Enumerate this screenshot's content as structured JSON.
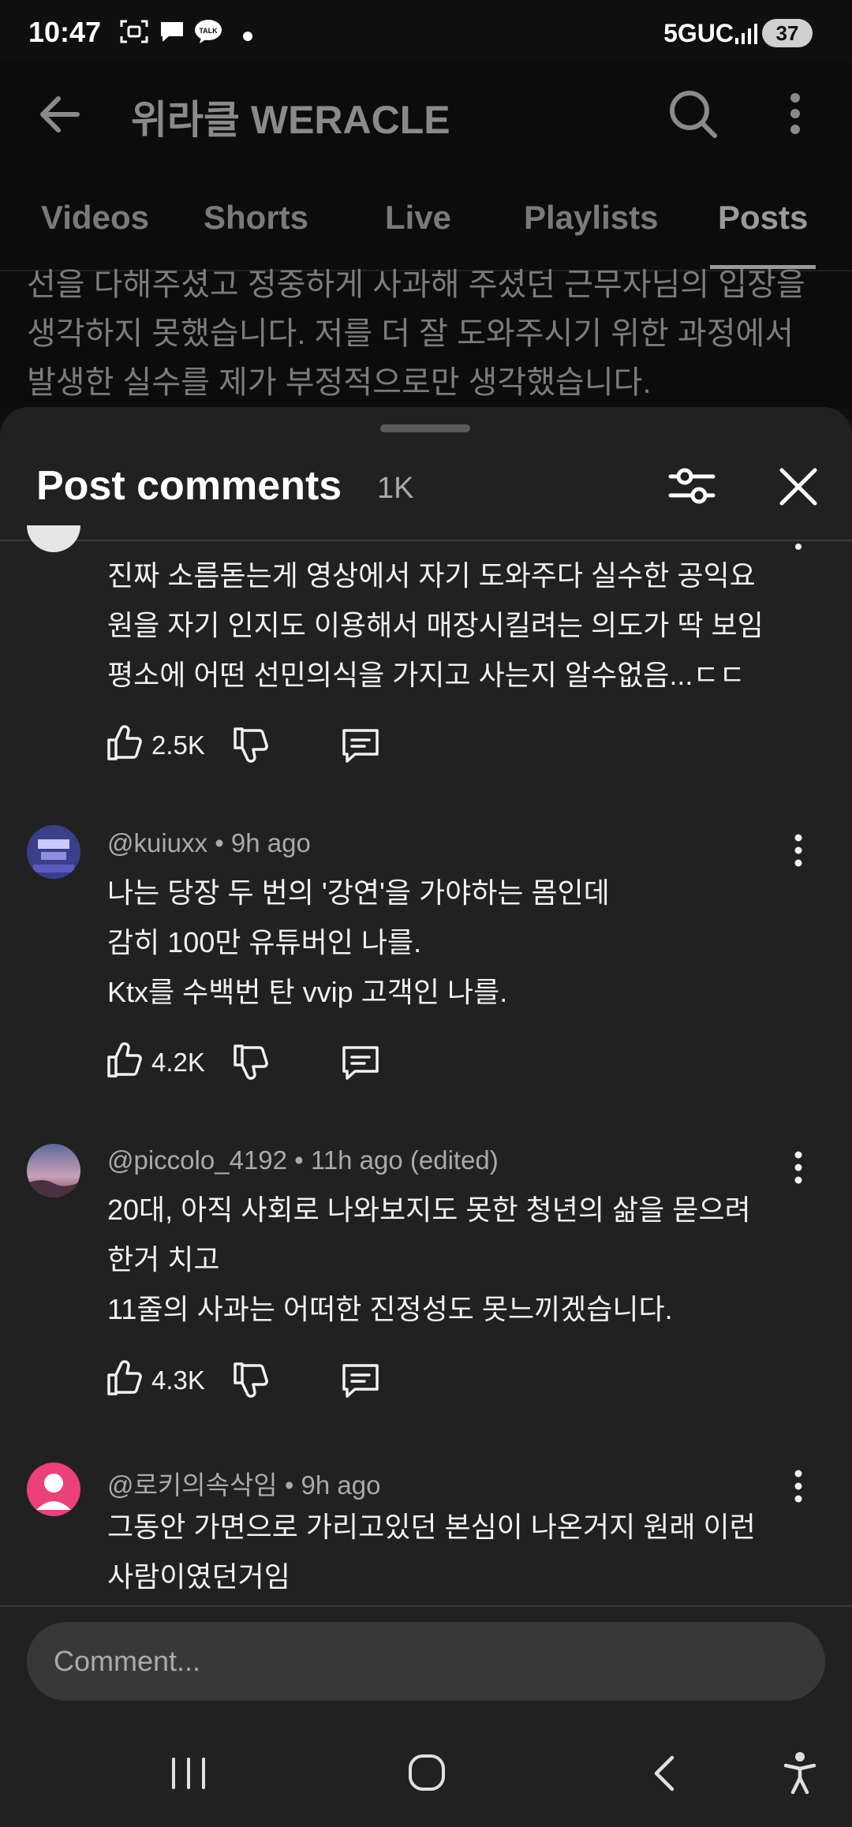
{
  "status": {
    "time": "10:47",
    "network": "5GUC",
    "battery": "37"
  },
  "channel": {
    "title": "위라클 WERACLE",
    "tabs": [
      "Videos",
      "Shorts",
      "Live",
      "Playlists",
      "Posts"
    ],
    "active_tab": "Posts",
    "post_text": "선을 다해주셨고 정중하게 사과해 주셨던 근무자님의 입장을 생각하지 못했습니다. 저를 더 잘 도와주시기 위한 과정에서 발생한 실수를 제가 부정적으로만 생각했습니다."
  },
  "sheet": {
    "title": "Post comments",
    "count": "1K"
  },
  "comments": [
    {
      "text": "진짜 소름돋는게 영상에서 자기 도와주다 실수한 공익요\n원을 자기 인지도 이용해서 매장시킬려는 의도가 딱 보임\n평소에 어떤 선민의식을 가지고 사는지 알수없음...ㄷㄷ",
      "likes": "2.5K"
    },
    {
      "author": "@kuiuxx • 9h ago",
      "text": "나는 당장 두 번의 '강연'을 가야하는 몸인데\n감히 100만 유튜버인 나를.\nKtx를 수백번 탄 vvip 고객인 나를.",
      "likes": "4.2K"
    },
    {
      "author": "@piccolo_4192 • 11h ago (edited)",
      "text": "20대, 아직 사회로 나와보지도 못한 청년의 삶을 묻으려\n한거 치고\n11줄의 사과는 어떠한 진정성도 못느끼겠습니다.",
      "likes": "4.3K"
    },
    {
      "author": "@로키의속삭임 • 9h ago",
      "text": "그동안 가면으로 가리고있던 본심이 나온거지 원래 이런\n사람이였던거임"
    }
  ],
  "input": {
    "placeholder": "Comment..."
  },
  "colors": {
    "background": "#0f0f0f",
    "sheet": "#212121",
    "input": "#383838"
  }
}
